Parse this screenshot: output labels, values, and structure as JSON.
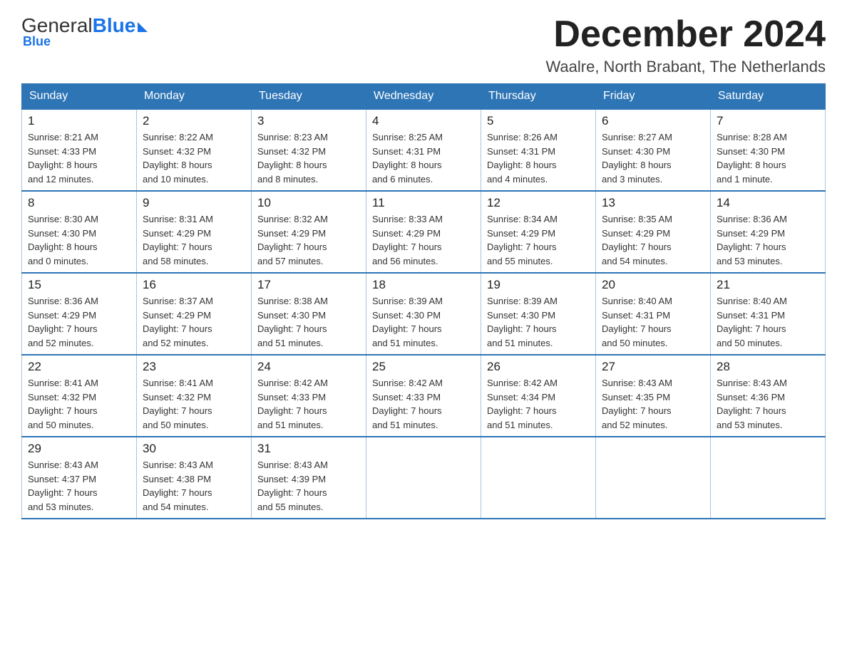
{
  "logo": {
    "general": "General",
    "blue": "Blue"
  },
  "title": {
    "month_year": "December 2024",
    "location": "Waalre, North Brabant, The Netherlands"
  },
  "days_of_week": [
    "Sunday",
    "Monday",
    "Tuesday",
    "Wednesday",
    "Thursday",
    "Friday",
    "Saturday"
  ],
  "weeks": [
    [
      {
        "day": "1",
        "sunrise": "8:21 AM",
        "sunset": "4:33 PM",
        "daylight": "8 hours and 12 minutes."
      },
      {
        "day": "2",
        "sunrise": "8:22 AM",
        "sunset": "4:32 PM",
        "daylight": "8 hours and 10 minutes."
      },
      {
        "day": "3",
        "sunrise": "8:23 AM",
        "sunset": "4:32 PM",
        "daylight": "8 hours and 8 minutes."
      },
      {
        "day": "4",
        "sunrise": "8:25 AM",
        "sunset": "4:31 PM",
        "daylight": "8 hours and 6 minutes."
      },
      {
        "day": "5",
        "sunrise": "8:26 AM",
        "sunset": "4:31 PM",
        "daylight": "8 hours and 4 minutes."
      },
      {
        "day": "6",
        "sunrise": "8:27 AM",
        "sunset": "4:30 PM",
        "daylight": "8 hours and 3 minutes."
      },
      {
        "day": "7",
        "sunrise": "8:28 AM",
        "sunset": "4:30 PM",
        "daylight": "8 hours and 1 minute."
      }
    ],
    [
      {
        "day": "8",
        "sunrise": "8:30 AM",
        "sunset": "4:30 PM",
        "daylight": "8 hours and 0 minutes."
      },
      {
        "day": "9",
        "sunrise": "8:31 AM",
        "sunset": "4:29 PM",
        "daylight": "7 hours and 58 minutes."
      },
      {
        "day": "10",
        "sunrise": "8:32 AM",
        "sunset": "4:29 PM",
        "daylight": "7 hours and 57 minutes."
      },
      {
        "day": "11",
        "sunrise": "8:33 AM",
        "sunset": "4:29 PM",
        "daylight": "7 hours and 56 minutes."
      },
      {
        "day": "12",
        "sunrise": "8:34 AM",
        "sunset": "4:29 PM",
        "daylight": "7 hours and 55 minutes."
      },
      {
        "day": "13",
        "sunrise": "8:35 AM",
        "sunset": "4:29 PM",
        "daylight": "7 hours and 54 minutes."
      },
      {
        "day": "14",
        "sunrise": "8:36 AM",
        "sunset": "4:29 PM",
        "daylight": "7 hours and 53 minutes."
      }
    ],
    [
      {
        "day": "15",
        "sunrise": "8:36 AM",
        "sunset": "4:29 PM",
        "daylight": "7 hours and 52 minutes."
      },
      {
        "day": "16",
        "sunrise": "8:37 AM",
        "sunset": "4:29 PM",
        "daylight": "7 hours and 52 minutes."
      },
      {
        "day": "17",
        "sunrise": "8:38 AM",
        "sunset": "4:30 PM",
        "daylight": "7 hours and 51 minutes."
      },
      {
        "day": "18",
        "sunrise": "8:39 AM",
        "sunset": "4:30 PM",
        "daylight": "7 hours and 51 minutes."
      },
      {
        "day": "19",
        "sunrise": "8:39 AM",
        "sunset": "4:30 PM",
        "daylight": "7 hours and 51 minutes."
      },
      {
        "day": "20",
        "sunrise": "8:40 AM",
        "sunset": "4:31 PM",
        "daylight": "7 hours and 50 minutes."
      },
      {
        "day": "21",
        "sunrise": "8:40 AM",
        "sunset": "4:31 PM",
        "daylight": "7 hours and 50 minutes."
      }
    ],
    [
      {
        "day": "22",
        "sunrise": "8:41 AM",
        "sunset": "4:32 PM",
        "daylight": "7 hours and 50 minutes."
      },
      {
        "day": "23",
        "sunrise": "8:41 AM",
        "sunset": "4:32 PM",
        "daylight": "7 hours and 50 minutes."
      },
      {
        "day": "24",
        "sunrise": "8:42 AM",
        "sunset": "4:33 PM",
        "daylight": "7 hours and 51 minutes."
      },
      {
        "day": "25",
        "sunrise": "8:42 AM",
        "sunset": "4:33 PM",
        "daylight": "7 hours and 51 minutes."
      },
      {
        "day": "26",
        "sunrise": "8:42 AM",
        "sunset": "4:34 PM",
        "daylight": "7 hours and 51 minutes."
      },
      {
        "day": "27",
        "sunrise": "8:43 AM",
        "sunset": "4:35 PM",
        "daylight": "7 hours and 52 minutes."
      },
      {
        "day": "28",
        "sunrise": "8:43 AM",
        "sunset": "4:36 PM",
        "daylight": "7 hours and 53 minutes."
      }
    ],
    [
      {
        "day": "29",
        "sunrise": "8:43 AM",
        "sunset": "4:37 PM",
        "daylight": "7 hours and 53 minutes."
      },
      {
        "day": "30",
        "sunrise": "8:43 AM",
        "sunset": "4:38 PM",
        "daylight": "7 hours and 54 minutes."
      },
      {
        "day": "31",
        "sunrise": "8:43 AM",
        "sunset": "4:39 PM",
        "daylight": "7 hours and 55 minutes."
      },
      null,
      null,
      null,
      null
    ]
  ],
  "labels": {
    "sunrise": "Sunrise:",
    "sunset": "Sunset:",
    "daylight": "Daylight:"
  }
}
